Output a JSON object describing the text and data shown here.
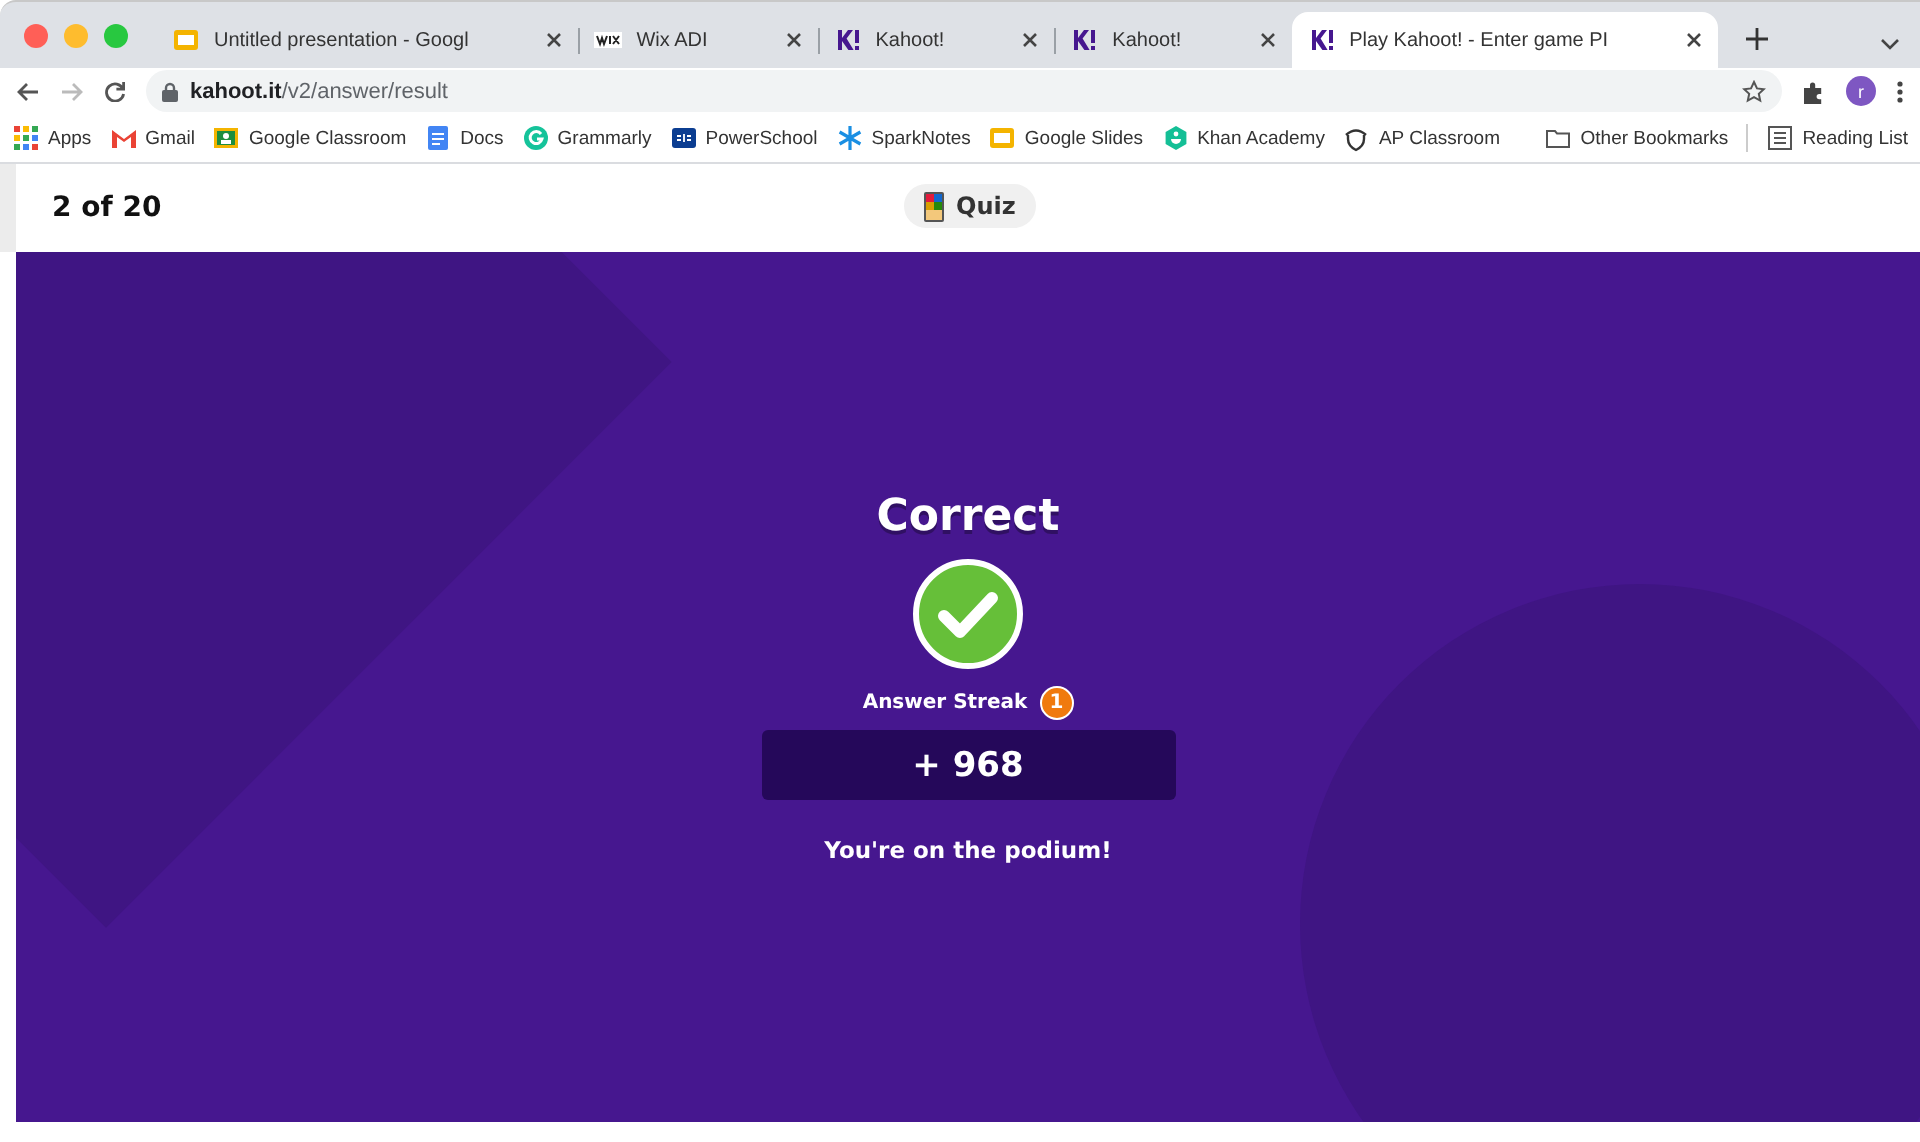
{
  "browser": {
    "tabs": [
      {
        "title": "Untitled presentation - Googl",
        "kind": "slides",
        "selected": false
      },
      {
        "title": "Wix ADI",
        "kind": "wix",
        "selected": false
      },
      {
        "title": "Kahoot!",
        "kind": "kahoot",
        "selected": false
      },
      {
        "title": "Kahoot!",
        "kind": "kahoot",
        "selected": false
      },
      {
        "title": "Play Kahoot! - Enter game PI",
        "kind": "kahoot",
        "selected": true
      }
    ],
    "address": {
      "host": "kahoot.it",
      "path": "/v2/answer/result"
    },
    "profile_initial": "r",
    "bookmarks": [
      {
        "label": "Apps",
        "kind": "apps"
      },
      {
        "label": "Gmail",
        "kind": "gmail"
      },
      {
        "label": "Google Classroom",
        "kind": "classroom"
      },
      {
        "label": "Docs",
        "kind": "docs"
      },
      {
        "label": "Grammarly",
        "kind": "grammarly"
      },
      {
        "label": "PowerSchool",
        "kind": "powerschool"
      },
      {
        "label": "SparkNotes",
        "kind": "sparknotes"
      },
      {
        "label": "Google Slides",
        "kind": "slides"
      },
      {
        "label": "Khan Academy",
        "kind": "khan"
      },
      {
        "label": "AP Classroom",
        "kind": "ap"
      }
    ],
    "bookmarks_right": [
      {
        "label": "Other Bookmarks",
        "kind": "folder"
      },
      {
        "label": "Reading List",
        "kind": "list"
      }
    ]
  },
  "header": {
    "progress": "2 of 20",
    "mode": "Quiz"
  },
  "result": {
    "heading": "Correct",
    "correct": true,
    "streak_label": "Answer Streak",
    "streak_count": "1",
    "points": "+ 968",
    "message": "You're on the podium!"
  }
}
